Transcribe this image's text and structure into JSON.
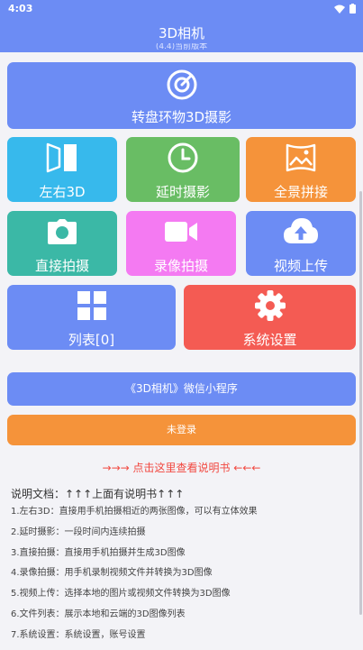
{
  "status_bar": {
    "time": "4:03"
  },
  "app_bar": {
    "title": "3D相机",
    "subtitle": "(4.4)当前版本"
  },
  "tiles": {
    "turntable": {
      "label": "转盘环物3D摄影",
      "icon": "target-icon"
    },
    "left_right_3d": {
      "label": "左右3D",
      "icon": "split-panel-icon"
    },
    "timelapse": {
      "label": "延时摄影",
      "icon": "clock-icon"
    },
    "panorama": {
      "label": "全景拼接",
      "icon": "panorama-icon"
    },
    "direct_shoot": {
      "label": "直接拍摄",
      "icon": "camera-icon"
    },
    "video_shoot": {
      "label": "录像拍摄",
      "icon": "video-camera-icon"
    },
    "video_upload": {
      "label": "视频上传",
      "icon": "cloud-upload-icon"
    },
    "file_list": {
      "label": "列表[0]",
      "icon": "grid-icon"
    },
    "settings": {
      "label": "系统设置",
      "icon": "gear-icon"
    }
  },
  "mini_program": {
    "label": "《3D相机》微信小程序"
  },
  "login": {
    "label": "未登录"
  },
  "guide_link": {
    "label": "→→→ 点击这里查看说明书 ←←←"
  },
  "doc": {
    "title": "说明文档：↑↑↑上面有说明书↑↑↑",
    "items": [
      "1.左右3D：直接用手机拍摄相近的两张图像，可以有立体效果",
      "2.延时摄影：一段时间内连续拍摄",
      "3.直接拍摄：直接用手机拍摄并生成3D图像",
      "4.录像拍摄：用手机录制视频文件并转换为3D图像",
      "5.视频上传：选择本地的图片或视频文件转换为3D图像",
      "6.文件列表：展示本地和云端的3D图像列表",
      "7.系统设置：系统设置，账号设置"
    ]
  },
  "colors": {
    "primary": "#6c8cf4",
    "cyan": "#37b9ec",
    "green": "#69bd64",
    "orange": "#f5933a",
    "teal": "#3bb8a6",
    "pink": "#f47af2",
    "red": "#f45b53",
    "link": "#f2473f"
  }
}
